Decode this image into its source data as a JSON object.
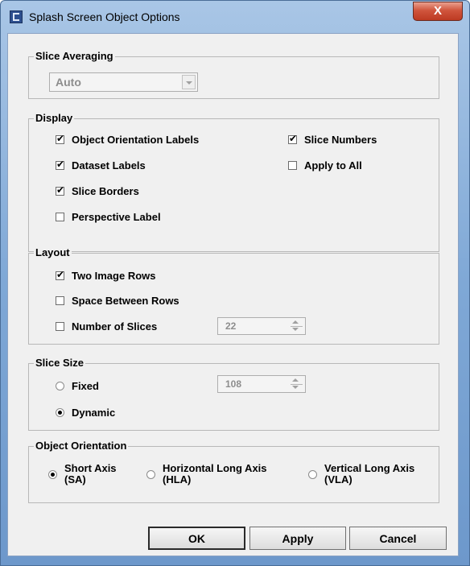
{
  "window": {
    "title": "Splash Screen Object Options",
    "close_label": "X"
  },
  "slice_averaging": {
    "legend": "Slice Averaging",
    "selected": "Auto",
    "enabled": false
  },
  "display": {
    "legend": "Display",
    "object_orientation_labels": {
      "label": "Object Orientation Labels",
      "checked": true
    },
    "slice_numbers": {
      "label": "Slice Numbers",
      "checked": true
    },
    "dataset_labels": {
      "label": "Dataset Labels",
      "checked": true
    },
    "apply_to_all": {
      "label": "Apply to All",
      "checked": false
    },
    "slice_borders": {
      "label": "Slice Borders",
      "checked": true
    },
    "perspective_label": {
      "label": "Perspective Label",
      "checked": false
    }
  },
  "layout": {
    "legend": "Layout",
    "two_image_rows": {
      "label": "Two Image Rows",
      "checked": true
    },
    "space_between_rows": {
      "label": "Space Between Rows",
      "checked": false
    },
    "number_of_slices": {
      "label": "Number of Slices",
      "checked": false,
      "value": "22"
    }
  },
  "slice_size": {
    "legend": "Slice Size",
    "fixed": {
      "label": "Fixed",
      "selected": false,
      "value": "108"
    },
    "dynamic": {
      "label": "Dynamic",
      "selected": true
    }
  },
  "object_orientation": {
    "legend": "Object Orientation",
    "short_axis": {
      "line1": "Short Axis",
      "line2": "(SA)",
      "selected": true
    },
    "horizontal_long_axis": {
      "line1": "Horizontal Long Axis",
      "line2": "(HLA)",
      "selected": false
    },
    "vertical_long_axis": {
      "line1": "Vertical Long Axis",
      "line2": "(VLA)",
      "selected": false
    }
  },
  "buttons": {
    "ok": "OK",
    "apply": "Apply",
    "cancel": "Cancel"
  }
}
